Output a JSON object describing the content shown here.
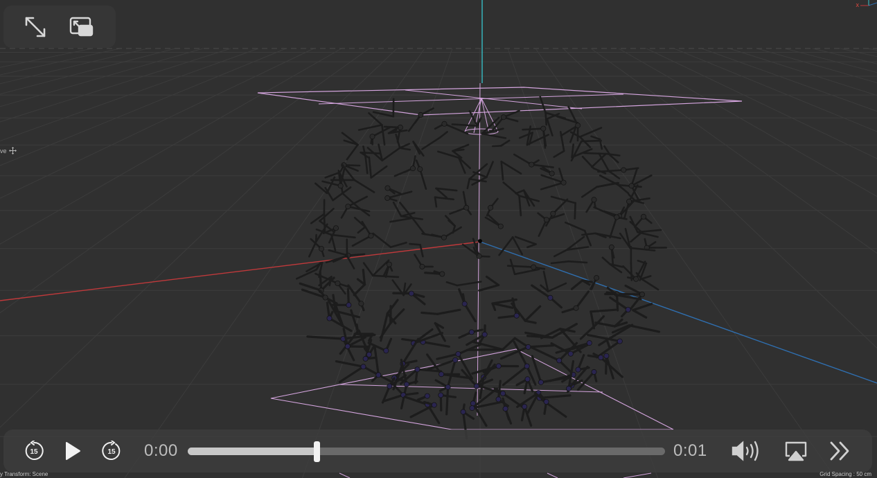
{
  "viewport": {
    "edge_label": "ve",
    "axis_x_label": "x",
    "status_left": "y Transform: Scene",
    "status_right": "Grid Spacing : 50 cm",
    "colors": {
      "background": "#303030",
      "grid": "#3c3c3c",
      "horizon": "#4a4a4a",
      "x_axis": "#c0393b",
      "z_axis": "#2f6fb0",
      "y_axis": "#38c8d0",
      "selection": "#d6a6e0",
      "strut": "#1c1c1c",
      "node": "#2a2550"
    }
  },
  "window_controls": {
    "fullscreen_icon": "expand-arrows-icon",
    "pip_icon": "picture-in-picture-icon"
  },
  "player": {
    "skip_back_label": "15",
    "skip_forward_label": "15",
    "current_time": "0:00",
    "duration": "0:01",
    "progress": 0.27,
    "icons": {
      "skip_back": "rewind-15-icon",
      "play": "play-icon",
      "skip_forward": "forward-15-icon",
      "volume": "speaker-volume-icon",
      "airplay": "airplay-icon",
      "more": "double-chevron-right-icon"
    }
  }
}
